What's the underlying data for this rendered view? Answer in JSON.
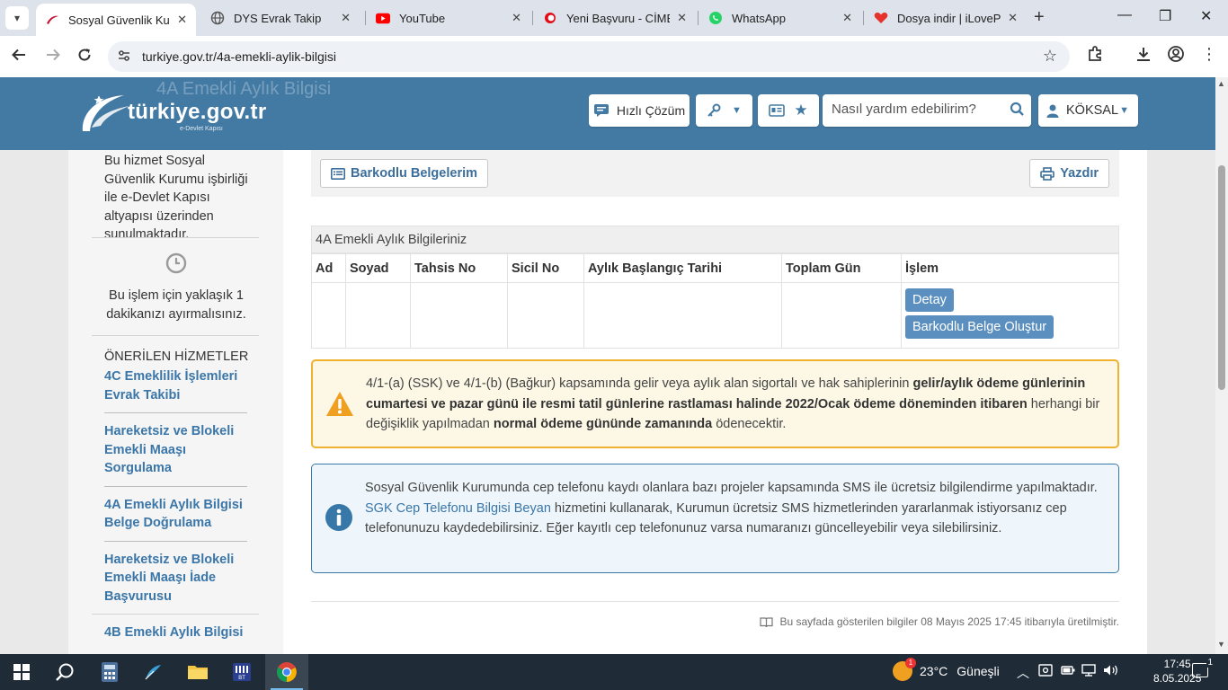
{
  "browser": {
    "tabs": [
      {
        "title": "Sosyal Güvenlik Kurumu",
        "favicon": "turkiye-gov-icon",
        "active": true
      },
      {
        "title": "DYS Evrak Takip",
        "favicon": "globe-icon",
        "active": false
      },
      {
        "title": "YouTube",
        "favicon": "youtube-icon",
        "active": false
      },
      {
        "title": "Yeni Başvuru - CİMER",
        "favicon": "cimer-icon",
        "active": false
      },
      {
        "title": "WhatsApp",
        "favicon": "whatsapp-icon",
        "active": false
      },
      {
        "title": "Dosya indir | iLovePDF",
        "favicon": "ilovepdf-icon",
        "active": false
      }
    ],
    "url": "turkiye.gov.tr/4a-emekli-aylik-bilgisi"
  },
  "header": {
    "ghost_title": "4A Emekli Aylık Bilgisi",
    "logo_text": "türkiye.gov.tr",
    "logo_tagline": "e-Devlet Kapısı",
    "quick_solution_label": "Hızlı Çözüm",
    "search_placeholder": "Nasıl yardım edebilirim?",
    "user_name": "KÖKSAL",
    "brand_color": "#437aa4"
  },
  "sidebar": {
    "description": "Bu hizmet Sosyal Güvenlik Kurumu işbirliği ile e-Devlet Kapısı altyapısı üzerinden sunulmaktadır.",
    "time_note": "Bu işlem için yaklaşık 1 dakikanızı ayırmalısınız.",
    "recommended_heading": "ÖNERİLEN HİZMETLER",
    "links": [
      "4C Emeklilik İşlemleri Evrak Takibi",
      "Hareketsiz ve Blokeli Emekli Maaşı Sorgulama",
      "4A Emekli Aylık Bilgisi Belge Doğrulama",
      "Hareketsiz ve Blokeli Emekli Maaşı İade Başvurusu",
      "4B Emekli Aylık Bilgisi"
    ]
  },
  "main": {
    "barcode_docs_button": "Barkodlu Belgelerim",
    "print_button": "Yazdır",
    "table": {
      "caption": "4A Emekli Aylık Bilgileriniz",
      "columns": [
        "Ad",
        "Soyad",
        "Tahsis No",
        "Sicil No",
        "Aylık Başlangıç Tarihi",
        "Toplam Gün",
        "İşlem"
      ],
      "rows": [
        {
          "ad": "",
          "soyad": "",
          "tahsis_no": "",
          "sicil_no": "",
          "baslangic": "",
          "toplam_gun": "",
          "actions": [
            "Detay",
            "Barkodlu Belge Oluştur"
          ]
        }
      ]
    },
    "warning": {
      "t1": "4/1-(a) (SSK) ve 4/1-(b) (Bağkur) kapsamında gelir veya aylık alan sigortalı ve hak sahiplerinin ",
      "b1": "gelir/aylık ödeme günlerinin cumartesi ve pazar günü ile resmi tatil günlerine rastlaması halinde 2022/Ocak ödeme döneminden itibaren",
      "t2": " herhangi bir değişiklik yapılmadan ",
      "b2": "normal ödeme gününde zamanında",
      "t3": " ödenecektir.",
      "color": "#f0b12c"
    },
    "info": {
      "t1": "Sosyal Güvenlik Kurumunda cep telefonu kaydı olanlara bazı projeler kapsamında SMS ile ücretsiz bilgilendirme yapılmaktadır. ",
      "link": "SGK Cep Telefonu Bilgisi Beyan",
      "t2": " hizmetini kullanarak, Kurumun ücretsiz SMS hizmetlerinden yararlanmak istiyorsanız cep telefonunuzu kaydedebilirsiniz. Eğer kayıtlı cep telefonunuz varsa numaranızı güncelleyebilir veya silebilirsiniz.",
      "color": "#3878a8"
    },
    "footnote": "Bu sayfada gösterilen bilgiler 08 Mayıs 2025 17:45 itibarıyla üretilmiştir."
  },
  "taskbar": {
    "weather_temp": "23°C",
    "weather_desc": "Güneşli",
    "weather_badge": "1",
    "time": "17:45",
    "date": "8.05.2025",
    "notification_count": "1"
  }
}
